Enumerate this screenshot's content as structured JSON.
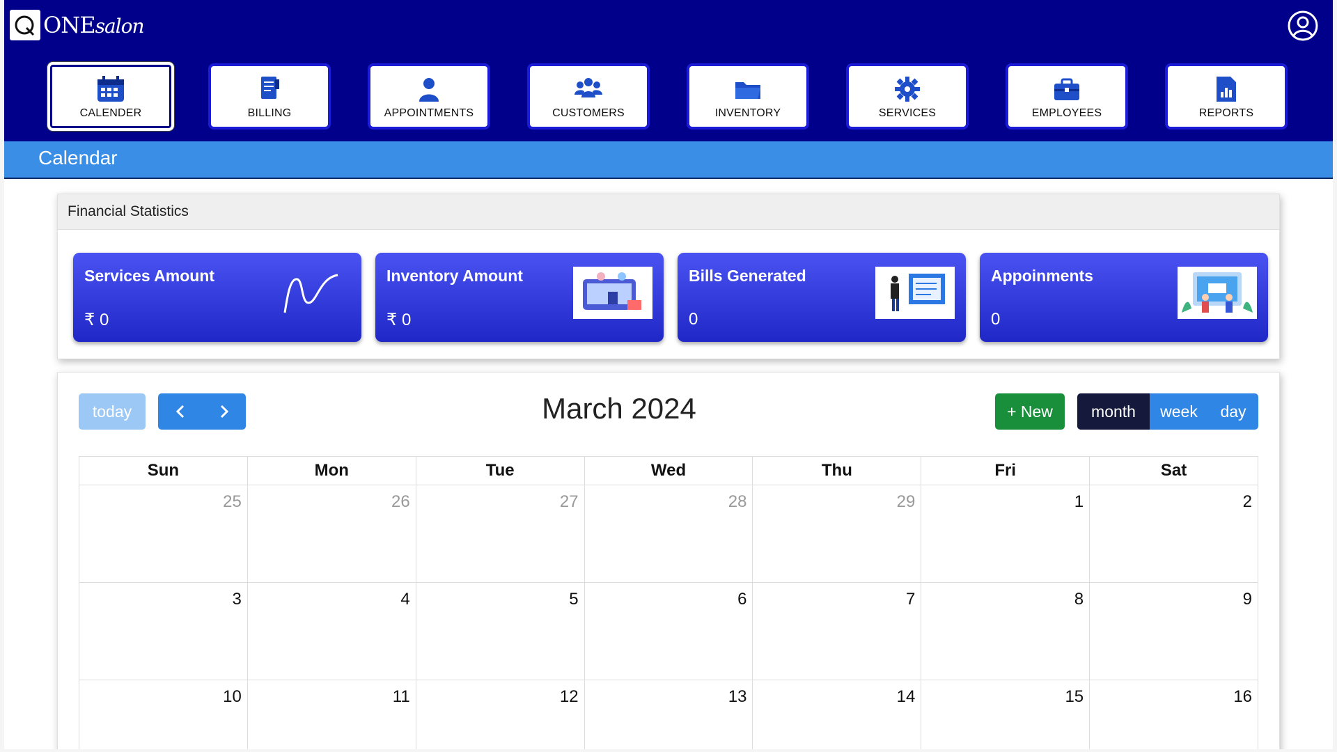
{
  "brand": {
    "badge": "Q",
    "name_main": "ONE",
    "name_script": "salon"
  },
  "header": {
    "user_icon": "user-circle-icon"
  },
  "nav": [
    {
      "label": "CALENDER",
      "icon": "calendar-icon",
      "active": true
    },
    {
      "label": "BILLING",
      "icon": "billing-icon"
    },
    {
      "label": "APPOINTMENTS",
      "icon": "person-icon"
    },
    {
      "label": "CUSTOMERS",
      "icon": "group-icon"
    },
    {
      "label": "INVENTORY",
      "icon": "folder-icon"
    },
    {
      "label": "SERVICES",
      "icon": "gear-icon"
    },
    {
      "label": "EMPLOYEES",
      "icon": "briefcase-icon"
    },
    {
      "label": "REPORTS",
      "icon": "report-icon"
    }
  ],
  "page_title": "Calendar",
  "stats": {
    "heading": "Financial Statistics",
    "cards": [
      {
        "title": "Services Amount",
        "value": "₹ 0"
      },
      {
        "title": "Inventory Amount",
        "value": "₹ 0"
      },
      {
        "title": "Bills Generated",
        "value": "0"
      },
      {
        "title": "Appoinments",
        "value": "0"
      }
    ]
  },
  "calendar": {
    "today_label": "today",
    "prev_label": "‹",
    "next_label": "›",
    "title": "March 2024",
    "new_label": "+ New",
    "views": {
      "month": "month",
      "week": "week",
      "day": "day"
    },
    "active_view": "month",
    "weekdays": [
      "Sun",
      "Mon",
      "Tue",
      "Wed",
      "Thu",
      "Fri",
      "Sat"
    ],
    "weeks": [
      [
        "25",
        "26",
        "27",
        "28",
        "29",
        "1",
        "2"
      ],
      [
        "3",
        "4",
        "5",
        "6",
        "7",
        "8",
        "9"
      ],
      [
        "10",
        "11",
        "12",
        "13",
        "14",
        "15",
        "16"
      ]
    ]
  },
  "colors": {
    "header_bg": "#00008b",
    "band_bg": "#3a8ee6",
    "card_gradient_top": "#4a53f2",
    "card_gradient_bottom": "#1f28c7",
    "primary_button": "#2f86e4",
    "new_button": "#198f3c",
    "active_view": "#151a3c"
  }
}
